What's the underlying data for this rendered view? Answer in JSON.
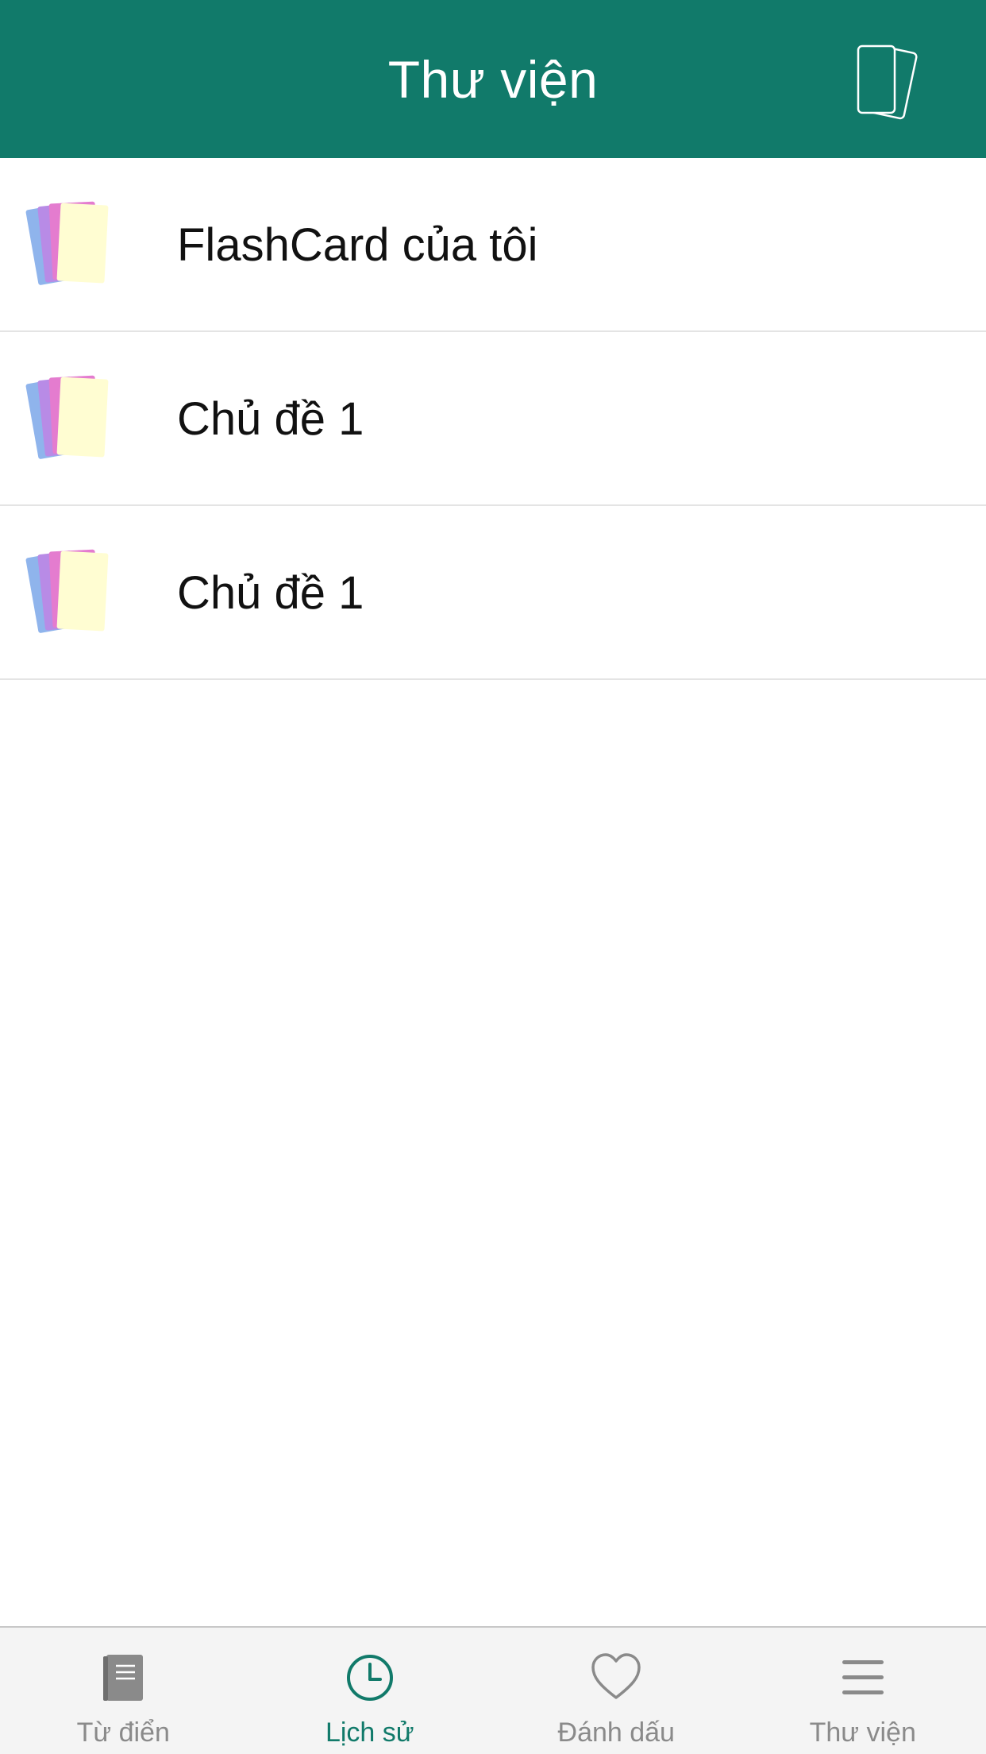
{
  "colors": {
    "header_bg": "#117a6a",
    "active_tab": "#117a6a",
    "inactive_tab": "#8a8a8a",
    "tabbar_bg": "#f4f4f4"
  },
  "header": {
    "title": "Thư viện",
    "action_icon": "flashcards-icon"
  },
  "list": {
    "items": [
      {
        "label": "FlashCard của tôi",
        "icon": "card-deck-icon"
      },
      {
        "label": "Chủ đề 1",
        "icon": "card-deck-icon"
      },
      {
        "label": "Chủ đề 1",
        "icon": "card-deck-icon"
      }
    ]
  },
  "tabbar": {
    "tabs": [
      {
        "label": "Từ điển",
        "icon": "dictionary-book-icon",
        "active": false
      },
      {
        "label": "Lịch sử",
        "icon": "clock-icon",
        "active": true
      },
      {
        "label": "Đánh dấu",
        "icon": "heart-icon",
        "active": false
      },
      {
        "label": "Thư viện",
        "icon": "menu-icon",
        "active": false
      }
    ]
  }
}
